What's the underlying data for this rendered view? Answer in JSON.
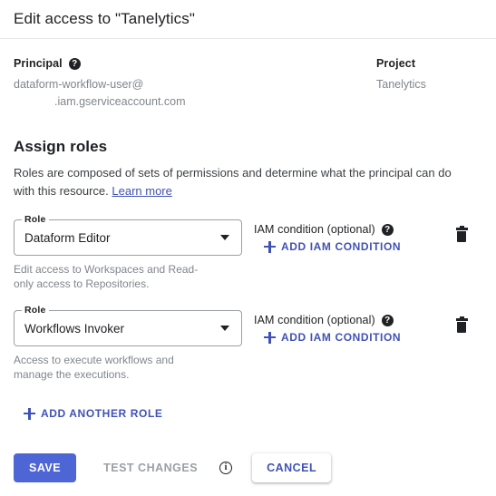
{
  "header": {
    "title": "Edit access to \"Tanelytics\""
  },
  "meta": {
    "principal": {
      "label": "Principal",
      "help_icon": "help-icon",
      "value_line1": "dataform-workflow-user@",
      "value_line2": ".iam.gserviceaccount.com"
    },
    "project": {
      "label": "Project",
      "value": "Tanelytics"
    }
  },
  "assign_roles": {
    "title": "Assign roles",
    "description": "Roles are composed of sets of permissions and determine what the principal can do with this resource.",
    "learn_more_label": "Learn more",
    "field_legend": "Role",
    "iam_condition_label": "IAM condition (optional)",
    "add_iam_condition_label": "ADD IAM CONDITION",
    "add_another_role_label": "ADD ANOTHER ROLE",
    "rows": [
      {
        "role": "Dataform Editor",
        "hint": "Edit access to Workspaces and Read-only access to Repositories."
      },
      {
        "role": "Workflows Invoker",
        "hint": "Access to execute workflows and manage the executions."
      }
    ]
  },
  "footer": {
    "save_label": "SAVE",
    "test_changes_label": "TEST CHANGES",
    "info_icon": "info-icon",
    "cancel_label": "CANCEL"
  },
  "colors": {
    "accent_blue": "#4e66d5",
    "link_blue": "#4052b5",
    "text_primary": "#202124",
    "text_secondary": "#80868b",
    "border": "#9aa0a6"
  }
}
